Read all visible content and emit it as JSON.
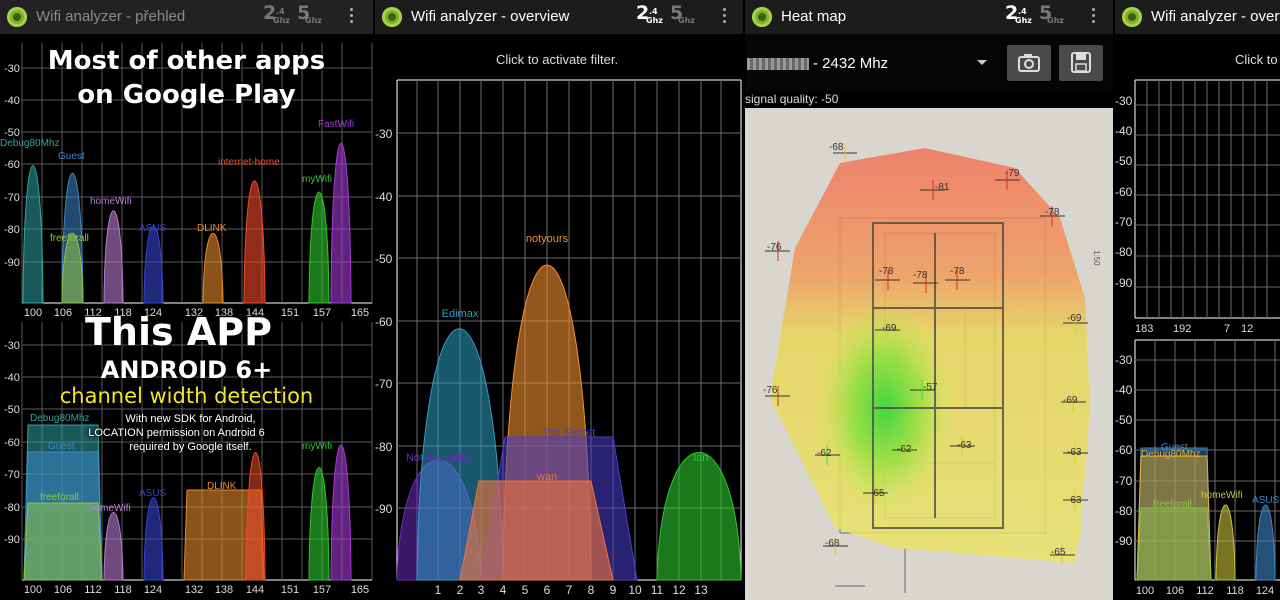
{
  "colors": {
    "accent": "#7fb02a",
    "grid": "#6a6a6a",
    "frame": "#ffffff"
  },
  "panel1": {
    "title": "Wifi analyzer - přehled",
    "band_24": {
      "big": "2",
      "small": ".4",
      "sub": "Ghz"
    },
    "band_5": {
      "big": "5",
      "sub": "Ghz"
    },
    "overlay_top": [
      "Most of other apps",
      "on Google Play"
    ],
    "overlay_app": "This APP",
    "overlay_android": "ANDROID 6+",
    "overlay_channel": "channel width detection",
    "overlay_note": [
      "With new SDK for Android,",
      "LOCATION permission on Android 6",
      "required by Google itself."
    ],
    "y_ticks": [
      "-30",
      "-40",
      "-50",
      "-60",
      "-70",
      "-80",
      "-90"
    ],
    "x_ticks": [
      "100",
      "106",
      "112",
      "118",
      "124",
      "132",
      "138",
      "144",
      "151",
      "157",
      "165"
    ],
    "networks_top": [
      {
        "name": "Debug80Mhz",
        "color": "#2fa4a4"
      },
      {
        "name": "Guest",
        "color": "#3d87c9"
      },
      {
        "name": "freeforall",
        "color": "#8dc24b"
      },
      {
        "name": "homeWifi",
        "color": "#b77bd1"
      },
      {
        "name": "ASUS",
        "color": "#3442c9"
      },
      {
        "name": "DLINK",
        "color": "#e48a2c"
      },
      {
        "name": "internet-home",
        "color": "#f0492a"
      },
      {
        "name": "myWifi",
        "color": "#2dc82d"
      },
      {
        "name": "FastWifi",
        "color": "#a33bd4"
      }
    ],
    "networks_bottom": [
      {
        "name": "Debug80Mhz",
        "color": "#2fa4a4"
      },
      {
        "name": "Guest",
        "color": "#3d87c9"
      },
      {
        "name": "freeforall",
        "color": "#8dc24b"
      },
      {
        "name": "homeWifi",
        "color": "#b77bd1"
      },
      {
        "name": "ASUS",
        "color": "#3442c9"
      },
      {
        "name": "DLINK",
        "color": "#e48a2c"
      },
      {
        "name": "myWifi",
        "color": "#2dc82d"
      }
    ]
  },
  "panel2": {
    "title": "Wifi analyzer - overview",
    "band_24": {
      "big": "2",
      "small": ".4",
      "sub": "Ghz"
    },
    "band_5": {
      "big": "5",
      "sub": "Ghz"
    },
    "filter_hint": "Click to activate filter.",
    "y_ticks": [
      "-30",
      "-40",
      "-50",
      "-60",
      "-70",
      "-80",
      "-90"
    ],
    "x_ticks": [
      "1",
      "2",
      "3",
      "4",
      "5",
      "6",
      "7",
      "8",
      "9",
      "10",
      "11",
      "12",
      "13"
    ],
    "networks": [
      {
        "name": "Not Available",
        "color": "#6b2bbd",
        "channel": 2,
        "dbm": -81
      },
      {
        "name": "Edimax",
        "color": "#2d9fc4",
        "channel": 2,
        "dbm": -58
      },
      {
        "name": "notyours",
        "color": "#f0902c",
        "channel": 6,
        "dbm": -47
      },
      {
        "name": "Top Secret",
        "color": "#4a3ed0",
        "channel": 7,
        "dbm": -78
      },
      {
        "name": "wan",
        "color": "#f0743a",
        "channel": 6,
        "dbm": -85
      },
      {
        "name": "lan",
        "color": "#2dc82d",
        "channel": 13,
        "dbm": -81
      }
    ]
  },
  "panel3": {
    "title": "Heat map",
    "band_24": {
      "big": "2",
      "small": ".4",
      "sub": "Ghz"
    },
    "band_5": {
      "big": "5",
      "sub": "Ghz"
    },
    "frequency": "- 2432 Mhz",
    "signal_quality": "signal quality: -50",
    "camera_icon": "camera-icon",
    "save_icon": "floppy-save-icon",
    "plan_scale": "1:50",
    "measurements": [
      "-68",
      "-81",
      "-79",
      "-78",
      "-76",
      "-78",
      "-78",
      "-78",
      "-69",
      "-69",
      "-76",
      "-57",
      "-69",
      "-63",
      "-62",
      "-62",
      "-63",
      "-65",
      "-63",
      "-68",
      "-65"
    ]
  },
  "panel4": {
    "title": "Wifi analyzer - overview",
    "filter_hint": "Click to",
    "y_ticks": [
      "-30",
      "-40",
      "-50",
      "-60",
      "-70",
      "-80",
      "-90"
    ],
    "x_ticks_top": [
      "183",
      "192",
      "7",
      "12"
    ],
    "x_ticks_bottom": [
      "100",
      "106",
      "112",
      "118",
      "124"
    ],
    "networks": [
      {
        "name": "Guest",
        "color": "#3d87c9"
      },
      {
        "name": "Debug80Mhz",
        "color": "#e0b030"
      },
      {
        "name": "freeforall",
        "color": "#8dc24b"
      },
      {
        "name": "homeWifi",
        "color": "#c9c23b"
      },
      {
        "name": "ASUS",
        "color": "#3d87c9"
      }
    ]
  }
}
